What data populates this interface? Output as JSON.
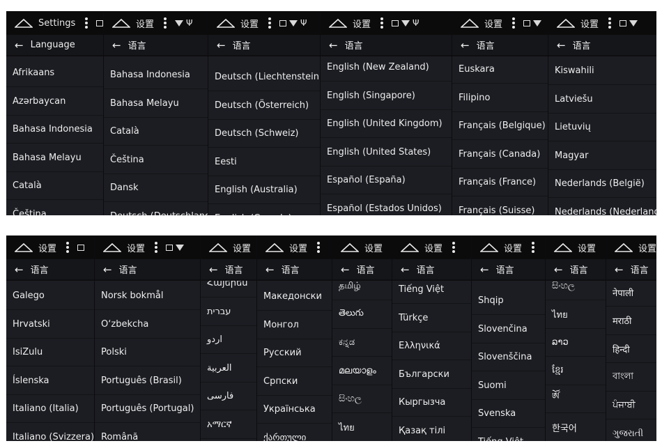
{
  "top_panels": [
    {
      "status_title": "Settings",
      "bar_title": "Language",
      "status_icons": [
        "portrait-icon"
      ],
      "offset": 4,
      "items": [
        "Afrikaans",
        "Azərbaycan",
        "Bahasa Indonesia",
        "Bahasa Melayu",
        "Català",
        "Čeština"
      ]
    },
    {
      "status_title": "设置",
      "bar_title": "语言",
      "status_icons": [
        "wifi-icon",
        "usb-icon"
      ],
      "offset": 7,
      "items": [
        "Bahasa Indonesia",
        "Bahasa Melayu",
        "Català",
        "Čeština",
        "Dansk",
        "Deutsch (Deutschland)"
      ]
    },
    {
      "status_title": "设置",
      "bar_title": "语言",
      "status_icons": [
        "picture-icon",
        "wifi-icon",
        "usb-icon"
      ],
      "offset": 10,
      "items": [
        "Deutsch (Liechtenstein)",
        "Deutsch (Österreich)",
        "Deutsch (Schweiz)",
        "Eesti",
        "English (Australia)",
        "English (Canada)"
      ]
    },
    {
      "status_title": "设置",
      "bar_title": "语言",
      "status_icons": [
        "picture-icon",
        "wifi-icon",
        "usb-icon"
      ],
      "offset": -4,
      "items": [
        "English (New Zealand)",
        "English (Singapore)",
        "English (United Kingdom)",
        "English (United States)",
        "Español (España)",
        "Español (Estados Unidos)"
      ]
    },
    {
      "status_title": "设置",
      "bar_title": "语言",
      "status_icons": [
        "picture-icon",
        "wifi-icon"
      ],
      "offset": -1,
      "items": [
        "Euskara",
        "Filipino",
        "Français (Belgique)",
        "Français (Canada)",
        "Français (France)",
        "Français (Suisse)"
      ]
    },
    {
      "status_title": "设置",
      "bar_title": "语言",
      "status_icons": [
        "picture-icon",
        "wifi-icon"
      ],
      "offset": 1,
      "items": [
        "Kiswahili",
        "Latviešu",
        "Lietuvių",
        "Magyar",
        "Nederlands (België)",
        "Nederlands (Nederland)"
      ]
    }
  ],
  "bottom_panels": [
    {
      "status_title": "设置",
      "bar_title": "语言",
      "status_icons": [
        "picture-icon"
      ],
      "offset": 2,
      "items": [
        "Galego",
        "Hrvatski",
        "IsiZulu",
        "Íslenska",
        "Italiano (Italia)",
        "Italiano (Svizzera)"
      ]
    },
    {
      "status_title": "设置",
      "bar_title": "语言",
      "status_icons": [
        "picture-icon",
        "wifi-icon"
      ],
      "offset": 2,
      "items": [
        "Norsk bokmål",
        "O‘zbekcha",
        "Polski",
        "Português (Brasil)",
        "Português (Portugal)",
        "Română"
      ]
    },
    {
      "status_title": "设置",
      "bar_title": "语言",
      "status_icons": [],
      "offset": -16,
      "items": [
        "Հայերեն",
        "עברית",
        "اردو",
        "العربية",
        "فارسی",
        "አማርኛ"
      ]
    },
    {
      "status_title": "设置",
      "bar_title": "语言",
      "status_icons": [],
      "offset": 3,
      "items": [
        "Македонски",
        "Монгол",
        "Русский",
        "Српски",
        "Українська",
        "ქართული"
      ]
    },
    {
      "status_title": "设置",
      "bar_title": "语言",
      "status_icons": [],
      "offset": -12,
      "items": [
        "தமிழ்",
        "తెలుగు",
        "ಕನ್ನಡ",
        "മലയാളം",
        "සිංහල",
        "ไทย"
      ]
    },
    {
      "status_title": "设置",
      "bar_title": "语言",
      "status_icons": [],
      "offset": -7,
      "items": [
        "Tiếng Việt",
        "Türkçe",
        "Ελληνικά",
        "Български",
        "Кыргызча",
        "Қазақ тілі"
      ]
    },
    {
      "status_title": "设置",
      "bar_title": "语言",
      "status_icons": [],
      "offset": 9,
      "items": [
        "Shqip",
        "Slovenčina",
        "Slovenščina",
        "Suomi",
        "Svenska",
        "Tiếng Việt"
      ]
    },
    {
      "status_title": "设置",
      "bar_title": "语言",
      "status_icons": [],
      "offset": -12,
      "items": [
        "සිංහල",
        "ไทย",
        "ລາວ",
        "ខ្មែរ",
        "ཨོ༹",
        "한국어"
      ]
    },
    {
      "status_title": "设置",
      "bar_title": "语言",
      "status_icons": [],
      "offset": -3,
      "items": [
        "नेपाली",
        "मराठी",
        "हिन्दी",
        "বাংলা",
        "ਪੰਜਾਬੀ",
        "ગુજરાતી"
      ]
    }
  ]
}
